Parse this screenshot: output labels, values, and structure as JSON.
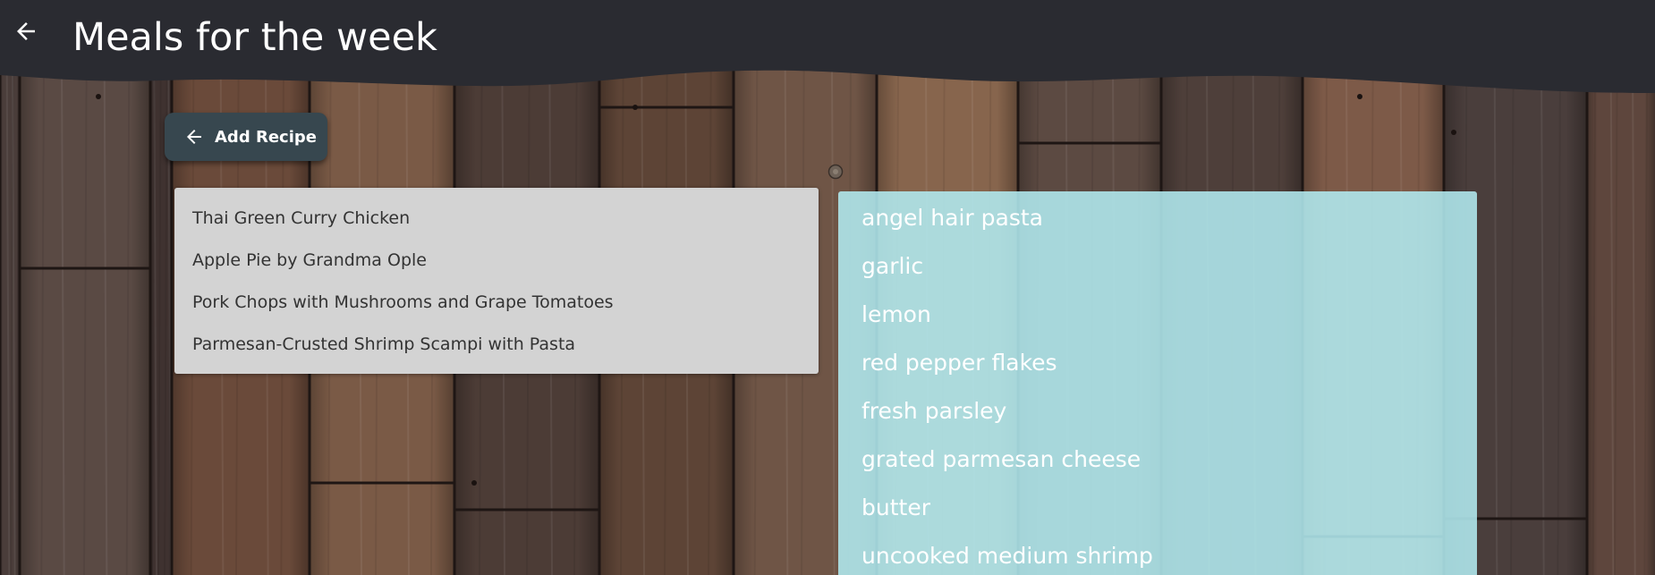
{
  "header": {
    "title": "Meals for the week",
    "back_icon": "arrow-left-icon",
    "background": "#2a2b31"
  },
  "toolbar": {
    "add_recipe_label": "Add Recipe",
    "add_recipe_icon": "arrow-left-icon",
    "button_color": "#37474f"
  },
  "recipes": {
    "items": [
      {
        "label": "Thai Green Curry Chicken"
      },
      {
        "label": "Apple Pie by Grandma Ople"
      },
      {
        "label": "Pork Chops with Mushrooms and Grape Tomatoes"
      },
      {
        "label": "Parmesan-Crusted Shrimp Scampi with Pasta"
      }
    ],
    "background": "#d3d3d3"
  },
  "ingredients": {
    "items": [
      {
        "label": "angel hair pasta"
      },
      {
        "label": "garlic"
      },
      {
        "label": "lemon"
      },
      {
        "label": "red pepper flakes"
      },
      {
        "label": "fresh parsley"
      },
      {
        "label": "grated parmesan cheese"
      },
      {
        "label": "butter"
      },
      {
        "label": "uncooked medium shrimp"
      }
    ],
    "background": "#b2ebf0"
  },
  "background": {
    "texture": "wood-planks"
  }
}
